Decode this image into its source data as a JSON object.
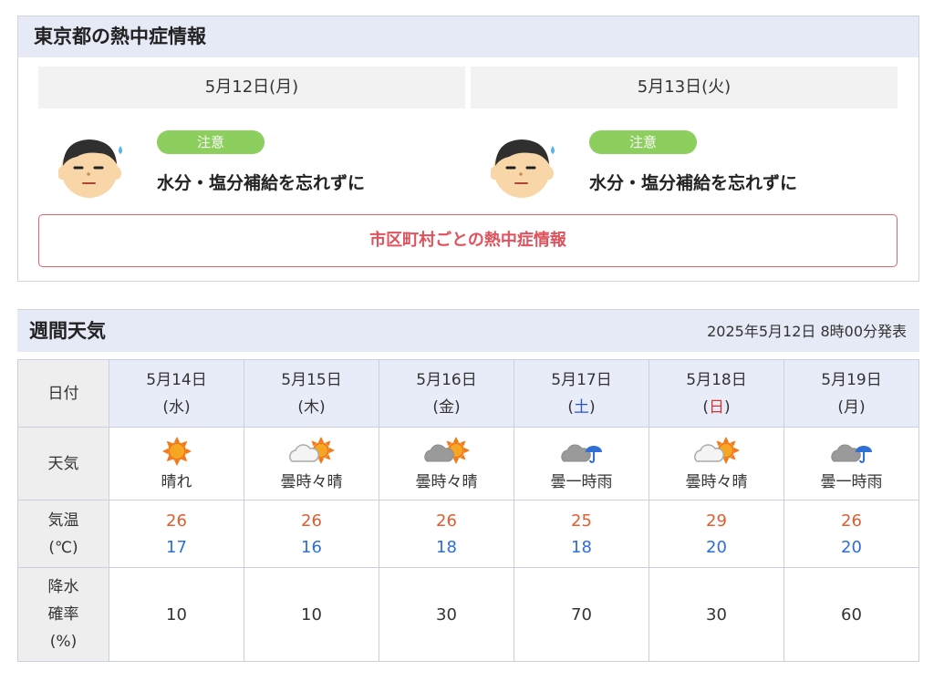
{
  "heat": {
    "title": "東京都の熱中症情報",
    "days": [
      {
        "date": "5月12日(月)",
        "level": "注意",
        "advice": "水分・塩分補給を忘れずに"
      },
      {
        "date": "5月13日(火)",
        "level": "注意",
        "advice": "水分・塩分補給を忘れずに"
      }
    ],
    "city_link": "市区町村ごとの熱中症情報",
    "colors": {
      "badge": "#8ccf5e",
      "link": "#e0525c"
    }
  },
  "weekly": {
    "title": "週間天気",
    "issued": "2025年5月12日 8時00分発表",
    "row_labels": {
      "date": "日付",
      "weather": "天気",
      "temp_line1": "気温",
      "temp_line2": "(℃)",
      "pop_line1": "降水",
      "pop_line2": "確率",
      "pop_line3": "(%)"
    },
    "days": [
      {
        "date": "5月14日",
        "dow": "水",
        "icon": "sun-icon",
        "weather": "晴れ",
        "max": "26",
        "min": "17",
        "pop": "10"
      },
      {
        "date": "5月15日",
        "dow": "木",
        "icon": "cloud-sun-icon",
        "weather": "曇時々晴",
        "max": "26",
        "min": "16",
        "pop": "10"
      },
      {
        "date": "5月16日",
        "dow": "金",
        "icon": "dark-cloud-sun-icon",
        "weather": "曇時々晴",
        "max": "26",
        "min": "18",
        "pop": "30"
      },
      {
        "date": "5月17日",
        "dow": "土",
        "icon": "cloud-umbrella-icon",
        "weather": "曇一時雨",
        "max": "25",
        "min": "18",
        "pop": "70"
      },
      {
        "date": "5月18日",
        "dow": "日",
        "icon": "cloud-sun-icon",
        "weather": "曇時々晴",
        "max": "29",
        "min": "20",
        "pop": "30"
      },
      {
        "date": "5月19日",
        "dow": "月",
        "icon": "cloud-umbrella-icon",
        "weather": "曇一時雨",
        "max": "26",
        "min": "20",
        "pop": "60"
      }
    ],
    "colors": {
      "max": "#e35b30",
      "min": "#2c6de0",
      "saturday": "#2b52d6",
      "sunday": "#d33333"
    }
  }
}
